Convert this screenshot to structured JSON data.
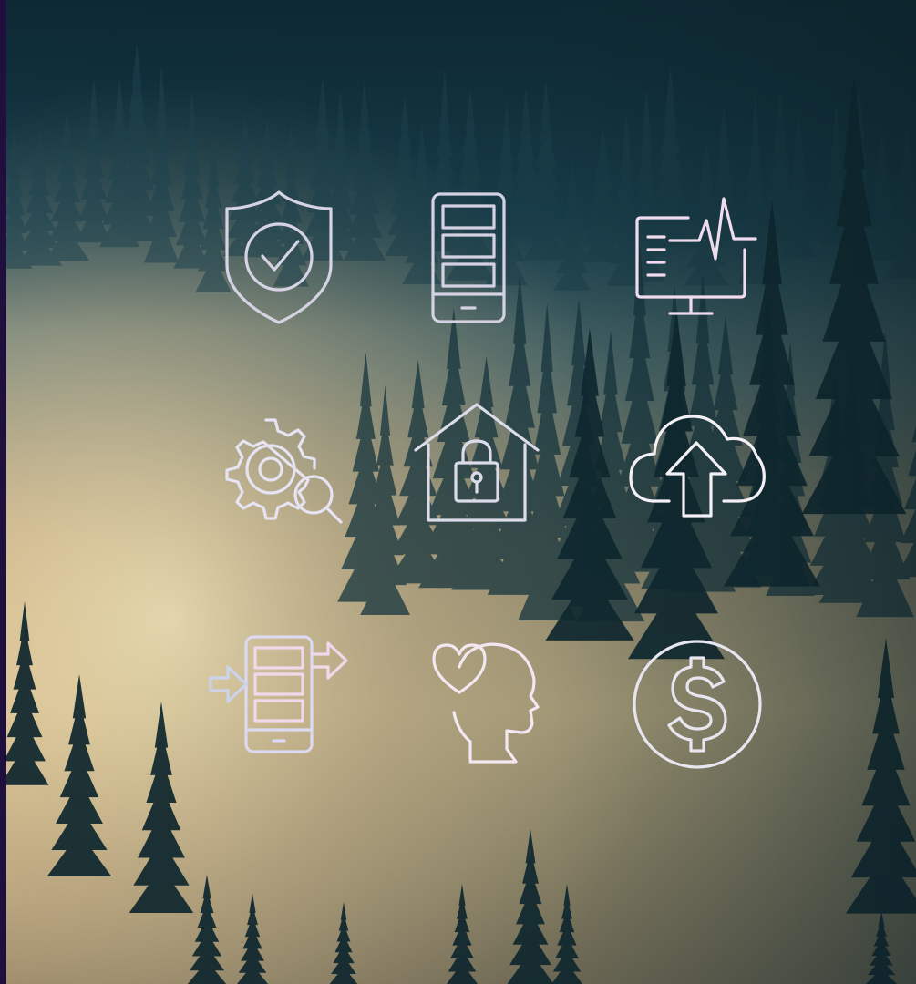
{
  "background": {
    "edge_color": "#1e0f3c",
    "sky_color": "#1f4254",
    "fog_color": "#d9c49a",
    "tree_color": "#0f2a31"
  },
  "icons": [
    {
      "name": "security-shield-check-icon",
      "color": "#d5d3e4"
    },
    {
      "name": "mobile-phone-app-icon",
      "color": "#d4d2e2"
    },
    {
      "name": "monitor-heartbeat-icon",
      "color": "#f1dbee"
    },
    {
      "name": "gear-search-icon",
      "color": "#e6e3f2"
    },
    {
      "name": "house-lock-icon",
      "color": "#dcdbea"
    },
    {
      "name": "cloud-upload-icon",
      "color": "#f3f0f6"
    },
    {
      "name": "phone-data-transfer-icon",
      "color": "#dcd9f0"
    },
    {
      "name": "mental-health-head-heart-icon",
      "color": "#f3e8f2"
    },
    {
      "name": "dollar-coin-icon",
      "color": "#e7e6f0"
    }
  ]
}
